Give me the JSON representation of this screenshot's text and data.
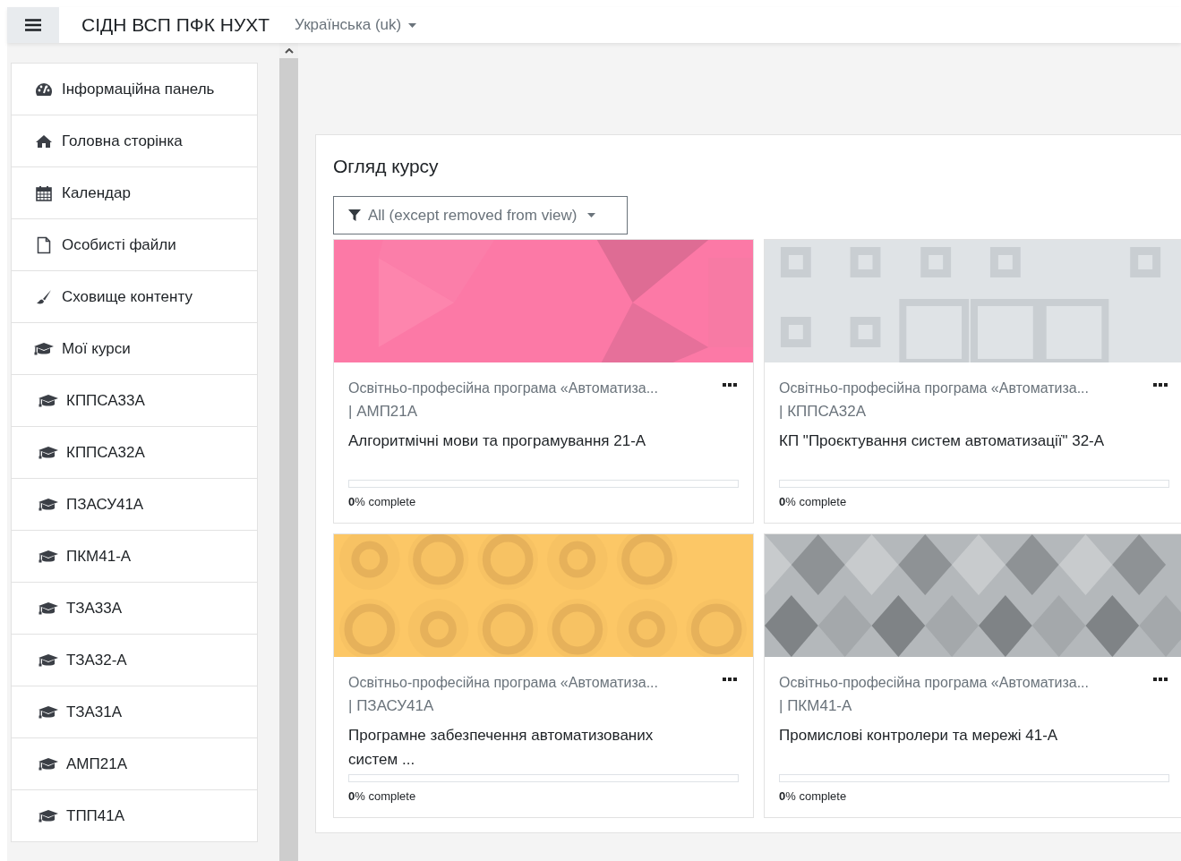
{
  "navbar": {
    "site_name": "СІДН ВСП ПФК НУХТ",
    "language": "Українська (uk)"
  },
  "sidebar": {
    "items": [
      {
        "kind": "dashboard",
        "label": "Інформаційна панель"
      },
      {
        "kind": "home",
        "label": "Головна сторінка"
      },
      {
        "kind": "calendar",
        "label": "Календар"
      },
      {
        "kind": "files",
        "label": "Особисті файли"
      },
      {
        "kind": "content",
        "label": "Сховище контенту"
      },
      {
        "kind": "courses",
        "label": "Мої курси"
      },
      {
        "kind": "course",
        "label": "КППСА33А"
      },
      {
        "kind": "course",
        "label": "КППСА32А"
      },
      {
        "kind": "course",
        "label": "ПЗАСУ41А"
      },
      {
        "kind": "course",
        "label": "ПКМ41-А"
      },
      {
        "kind": "course",
        "label": "ТЗА33А"
      },
      {
        "kind": "course",
        "label": "ТЗА32-А"
      },
      {
        "kind": "course",
        "label": "ТЗА31А"
      },
      {
        "kind": "course",
        "label": "АМП21А"
      },
      {
        "kind": "course",
        "label": "ТПП41А"
      }
    ]
  },
  "course_overview": {
    "title": "Огляд курсу",
    "filter": "All (except removed from view)",
    "courses": [
      {
        "category": "Освітньо-професійна програма «Автоматиза...",
        "group": "| АМП21А",
        "name": "Алгоритмічні мови та програмування 21-А",
        "level": 0,
        "progress": "**0**% complete"
      },
      {
        "category": "Освітньо-професійна програма «Автоматиза...",
        "group": "| КППСА32А",
        "name": "КП \"Проєктування систем автоматизації\" 32-А",
        "level": 0,
        "progress": "**0**% complete"
      },
      {
        "category": "Освітньо-професійна програма «Автоматиза...",
        "group": "| ПЗАСУ41А",
        "name": "Програмне забезпечення автоматизованих систем ...",
        "level": 0,
        "progress": "**0**% complete"
      },
      {
        "category": "Освітньо-професійна програма «Автоматиза...",
        "group": "| ПКМ41-А",
        "name": "Промислові контролери та мережі 41-А",
        "level": 0,
        "progress": "**0**% complete"
      }
    ]
  }
}
